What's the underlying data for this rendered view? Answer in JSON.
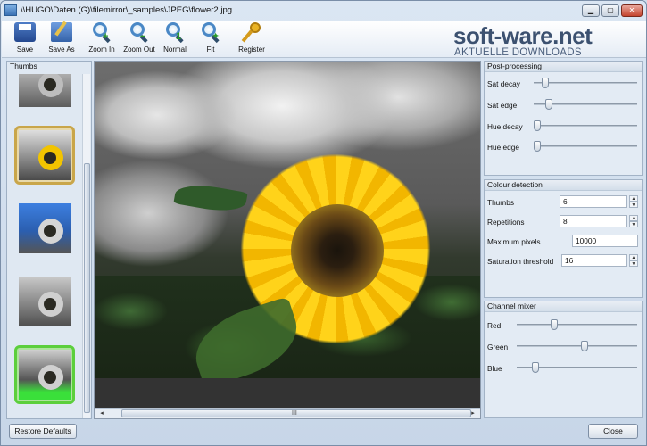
{
  "window": {
    "title": "\\\\HUGO\\Daten (G)\\filemirror\\_samples\\JPEG\\flower2.jpg",
    "min_glyph": "▁",
    "max_glyph": "▢",
    "close_glyph": "✕"
  },
  "toolbar": {
    "items": [
      {
        "label": "Save",
        "icon": "save-icon"
      },
      {
        "label": "Save As",
        "icon": "save-as-icon"
      },
      {
        "label": "Zoom In",
        "icon": "zoom-in-icon",
        "badge": "+"
      },
      {
        "label": "Zoom Out",
        "icon": "zoom-out-icon",
        "badge": "−"
      },
      {
        "label": "Normal",
        "icon": "zoom-normal-icon",
        "badge": "1"
      },
      {
        "label": "Fit",
        "icon": "zoom-fit-icon",
        "badge": "✦"
      },
      {
        "label": "Register",
        "icon": "key-icon"
      }
    ]
  },
  "watermark": {
    "main": "soft-ware.net",
    "sub": "AKTUELLE DOWNLOADS"
  },
  "thumbs_panel": {
    "title": "Thumbs"
  },
  "viewer": {
    "grip": "III",
    "left_arrow": "◂",
    "right_arrow": "▸"
  },
  "post_processing": {
    "title": "Post-processing",
    "sliders": [
      {
        "label": "Sat decay",
        "value": 0.08
      },
      {
        "label": "Sat edge",
        "value": 0.12
      },
      {
        "label": "Hue decay",
        "value": 0.0
      },
      {
        "label": "Hue edge",
        "value": 0.0
      }
    ]
  },
  "colour_detection": {
    "title": "Colour detection",
    "fields": [
      {
        "label": "Thumbs",
        "value": "6",
        "spin": true
      },
      {
        "label": "Repetitions",
        "value": "8",
        "spin": true
      },
      {
        "label": "Maximum pixels",
        "value": "10000",
        "spin": false
      },
      {
        "label": "Saturation threshold",
        "value": "16",
        "spin": true
      }
    ]
  },
  "channel_mixer": {
    "title": "Channel mixer",
    "sliders": [
      {
        "label": "Red",
        "value": 0.3
      },
      {
        "label": "Green",
        "value": 0.57
      },
      {
        "label": "Blue",
        "value": 0.13
      }
    ]
  },
  "footer": {
    "restore_label": "Restore Defaults",
    "close_label": "Close"
  },
  "colors": {
    "accent_gold": "#c9a64a",
    "accent_green": "#5ccf3c",
    "sunflower": "#ffd31a"
  }
}
